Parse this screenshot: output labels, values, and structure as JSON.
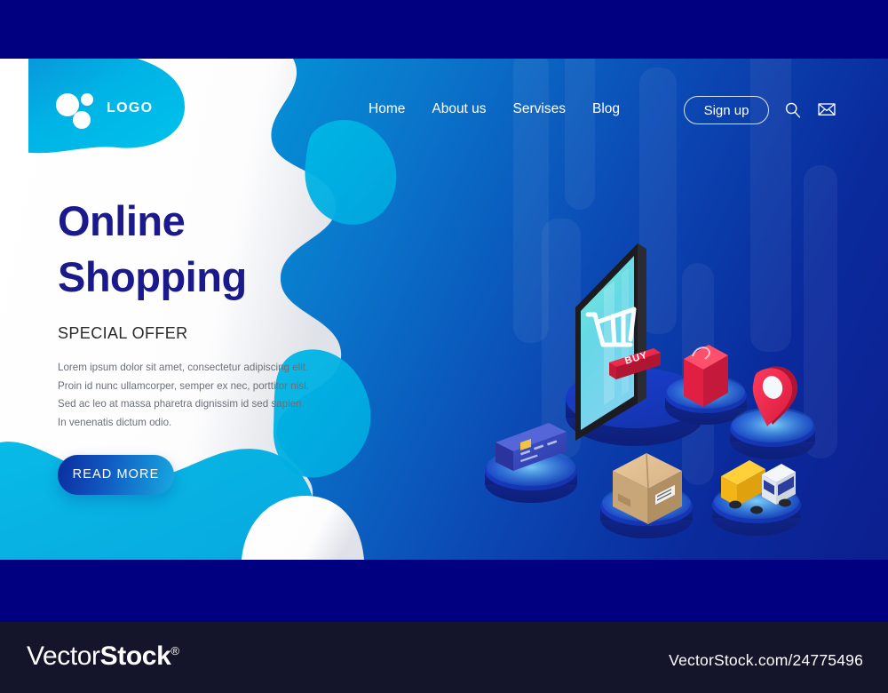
{
  "brand": {
    "logo_text": "LOGO"
  },
  "nav": {
    "items": [
      {
        "label": "Home"
      },
      {
        "label": "About us"
      },
      {
        "label": "Servises"
      },
      {
        "label": "Blog"
      }
    ],
    "signup_label": "Sign up",
    "search_icon": "search-icon",
    "mail_icon": "envelope-icon"
  },
  "hero": {
    "title_line1": "Online",
    "title_line2": "Shopping",
    "subtitle": "SPECIAL OFFER",
    "paragraph": "Lorem ipsum dolor sit amet, consectetur adipiscing elit. Proin id nunc ullamcorper, semper ex nec, porttitor nisl. Sed ac leo at massa pharetra dignissim id sed sapien. In venenatis dictum odio.",
    "cta_label": "READ MORE"
  },
  "illustration": {
    "phone_buy_label": "BUY",
    "cart_icon": "shopping-cart-icon",
    "items": [
      {
        "name": "credit-card-icon"
      },
      {
        "name": "parcel-box-icon"
      },
      {
        "name": "shopping-bag-icon"
      },
      {
        "name": "location-pin-icon"
      },
      {
        "name": "delivery-truck-icon"
      }
    ]
  },
  "footer": {
    "logo_vector": "Vector",
    "logo_stock": "Stock",
    "logo_reg": "®",
    "url": "VectorStock.com/24775496"
  },
  "colors": {
    "navy_frame": "#000080",
    "footer_bg": "#14142a",
    "heading": "#1a1a8c",
    "cyan": "#00b5e2",
    "deep_blue": "#0d1f8f",
    "accent_red": "#ea2b4b",
    "cta_gradient_from": "#0b2d9e",
    "cta_gradient_to": "#18a8e0"
  }
}
